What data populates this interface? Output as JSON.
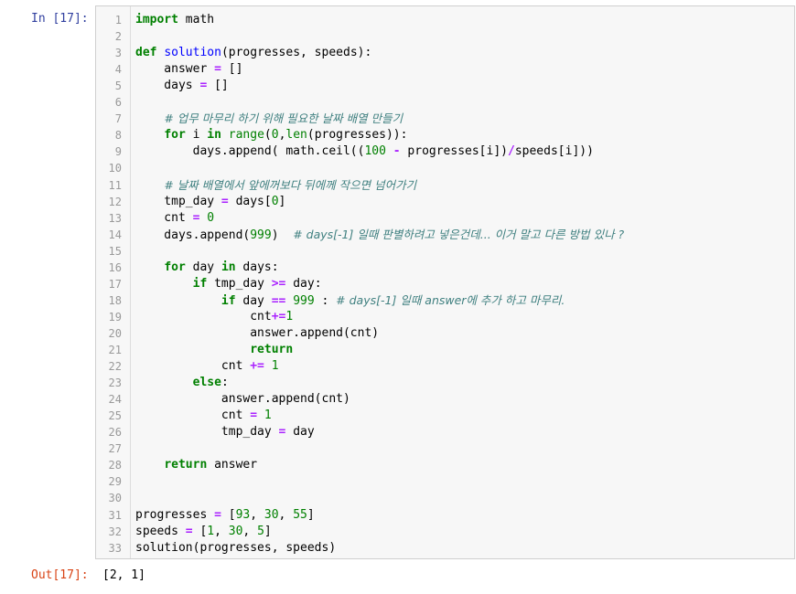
{
  "cell": {
    "in_prompt": "In [17]:",
    "out_prompt": "Out[17]:",
    "output_text": "[2, 1]",
    "line_numbers": [
      "1",
      "2",
      "3",
      "4",
      "5",
      "6",
      "7",
      "8",
      "9",
      "10",
      "11",
      "12",
      "13",
      "14",
      "15",
      "16",
      "17",
      "18",
      "19",
      "20",
      "21",
      "22",
      "23",
      "24",
      "25",
      "26",
      "27",
      "28",
      "29",
      "30",
      "31",
      "32",
      "33"
    ],
    "lines": [
      [
        [
          "kw",
          "import"
        ],
        [
          "t",
          " math"
        ]
      ],
      [],
      [
        [
          "kw",
          "def"
        ],
        [
          "t",
          " "
        ],
        [
          "fn",
          "solution"
        ],
        [
          "t",
          "(progresses, speeds):"
        ]
      ],
      [
        [
          "t",
          "    answer "
        ],
        [
          "op",
          "="
        ],
        [
          "t",
          " []"
        ]
      ],
      [
        [
          "t",
          "    days "
        ],
        [
          "op",
          "="
        ],
        [
          "t",
          " []"
        ]
      ],
      [],
      [
        [
          "t",
          "    "
        ],
        [
          "cm",
          "# 업무 마무리 하기 위해 필요한 날짜 배열 만들기"
        ]
      ],
      [
        [
          "t",
          "    "
        ],
        [
          "kw",
          "for"
        ],
        [
          "t",
          " i "
        ],
        [
          "kw",
          "in"
        ],
        [
          "t",
          " "
        ],
        [
          "nb",
          "range"
        ],
        [
          "t",
          "("
        ],
        [
          "num",
          "0"
        ],
        [
          "t",
          ","
        ],
        [
          "nb",
          "len"
        ],
        [
          "t",
          "(progresses)):"
        ]
      ],
      [
        [
          "t",
          "        days.append( math.ceil(("
        ],
        [
          "num",
          "100"
        ],
        [
          "t",
          " "
        ],
        [
          "op",
          "-"
        ],
        [
          "t",
          " progresses[i])"
        ],
        [
          "op",
          "/"
        ],
        [
          "t",
          "speeds[i]))"
        ]
      ],
      [],
      [
        [
          "t",
          "    "
        ],
        [
          "cm",
          "# 날짜 배열에서 앞에꺼보다 뒤에께 작으면 넘어가기"
        ]
      ],
      [
        [
          "t",
          "    tmp_day "
        ],
        [
          "op",
          "="
        ],
        [
          "t",
          " days["
        ],
        [
          "num",
          "0"
        ],
        [
          "t",
          "]"
        ]
      ],
      [
        [
          "t",
          "    cnt "
        ],
        [
          "op",
          "="
        ],
        [
          "t",
          " "
        ],
        [
          "num",
          "0"
        ]
      ],
      [
        [
          "t",
          "    days.append("
        ],
        [
          "num",
          "999"
        ],
        [
          "t",
          ")  "
        ],
        [
          "cm",
          "# days[-1] 일때 판별하려고 넣은건데... 이거 말고 다른 방법 있나 ?"
        ]
      ],
      [],
      [
        [
          "t",
          "    "
        ],
        [
          "kw",
          "for"
        ],
        [
          "t",
          " day "
        ],
        [
          "kw",
          "in"
        ],
        [
          "t",
          " days:"
        ]
      ],
      [
        [
          "t",
          "        "
        ],
        [
          "kw",
          "if"
        ],
        [
          "t",
          " tmp_day "
        ],
        [
          "op",
          ">="
        ],
        [
          "t",
          " day:"
        ]
      ],
      [
        [
          "t",
          "            "
        ],
        [
          "kw",
          "if"
        ],
        [
          "t",
          " day "
        ],
        [
          "op",
          "=="
        ],
        [
          "t",
          " "
        ],
        [
          "num",
          "999"
        ],
        [
          "t",
          " : "
        ],
        [
          "cm",
          "# days[-1] 일때 answer에 추가 하고 마무리."
        ]
      ],
      [
        [
          "t",
          "                cnt"
        ],
        [
          "op",
          "+="
        ],
        [
          "num",
          "1"
        ]
      ],
      [
        [
          "t",
          "                answer.append(cnt)"
        ]
      ],
      [
        [
          "t",
          "                "
        ],
        [
          "kw",
          "return"
        ]
      ],
      [
        [
          "t",
          "            cnt "
        ],
        [
          "op",
          "+="
        ],
        [
          "t",
          " "
        ],
        [
          "num",
          "1"
        ]
      ],
      [
        [
          "t",
          "        "
        ],
        [
          "kw",
          "else"
        ],
        [
          "t",
          ":"
        ]
      ],
      [
        [
          "t",
          "            answer.append(cnt)"
        ]
      ],
      [
        [
          "t",
          "            cnt "
        ],
        [
          "op",
          "="
        ],
        [
          "t",
          " "
        ],
        [
          "num",
          "1"
        ]
      ],
      [
        [
          "t",
          "            tmp_day "
        ],
        [
          "op",
          "="
        ],
        [
          "t",
          " day"
        ]
      ],
      [],
      [
        [
          "t",
          "    "
        ],
        [
          "kw",
          "return"
        ],
        [
          "t",
          " answer"
        ]
      ],
      [],
      [],
      [
        [
          "t",
          "progresses "
        ],
        [
          "op",
          "="
        ],
        [
          "t",
          " ["
        ],
        [
          "num",
          "93"
        ],
        [
          "t",
          ", "
        ],
        [
          "num",
          "30"
        ],
        [
          "t",
          ", "
        ],
        [
          "num",
          "55"
        ],
        [
          "t",
          "]"
        ]
      ],
      [
        [
          "t",
          "speeds "
        ],
        [
          "op",
          "="
        ],
        [
          "t",
          " ["
        ],
        [
          "num",
          "1"
        ],
        [
          "t",
          ", "
        ],
        [
          "num",
          "30"
        ],
        [
          "t",
          ", "
        ],
        [
          "num",
          "5"
        ],
        [
          "t",
          "]"
        ]
      ],
      [
        [
          "t",
          "solution(progresses, speeds)"
        ]
      ]
    ]
  }
}
